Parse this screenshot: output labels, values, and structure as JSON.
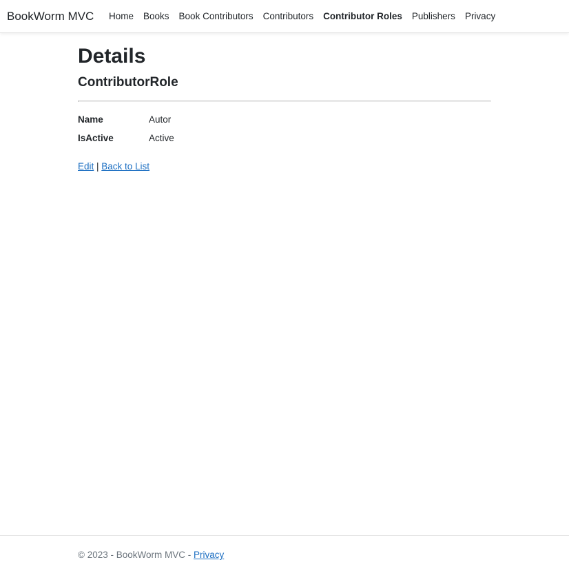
{
  "navbar": {
    "brand": "BookWorm MVC",
    "links": [
      {
        "label": "Home"
      },
      {
        "label": "Books"
      },
      {
        "label": "Book Contributors"
      },
      {
        "label": "Contributors"
      },
      {
        "label": "Contributor Roles"
      },
      {
        "label": "Publishers"
      },
      {
        "label": "Privacy"
      }
    ]
  },
  "main": {
    "title": "Details",
    "entity": "ContributorRole",
    "fields": [
      {
        "label": "Name",
        "value": "Autor"
      },
      {
        "label": "IsActive",
        "value": "Active"
      }
    ],
    "actions": {
      "edit_label": "Edit",
      "separator": " | ",
      "back_label": "Back to List"
    }
  },
  "footer": {
    "text": "© 2023 - BookWorm MVC - ",
    "privacy_label": "Privacy"
  }
}
